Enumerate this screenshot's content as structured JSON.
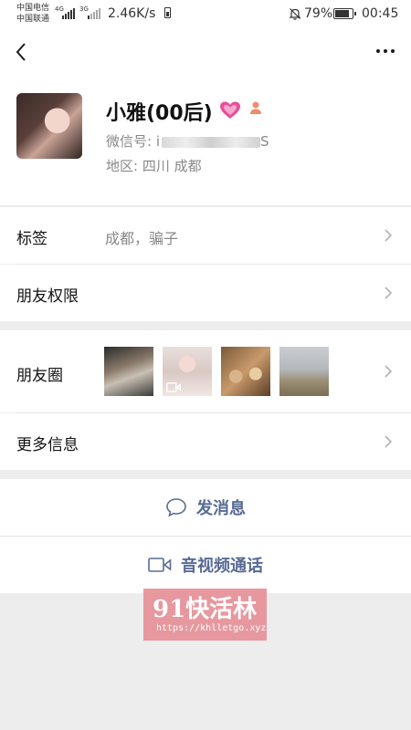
{
  "status_bar": {
    "carrier_1": "中国电信",
    "carrier_2": "中国联通",
    "network_1": "4G",
    "network_2": "3G",
    "speed": "2.46K/s",
    "battery_percent": "79%",
    "time": "00:45"
  },
  "profile": {
    "nickname": "小雅(00后)",
    "wechat_id_label": "微信号:",
    "wechat_id_value_visible": "i",
    "wechat_id_value_end": "S",
    "region_label": "地区:",
    "region_value": "四川  成都",
    "emoji": "💓"
  },
  "rows": {
    "tags_label": "标签",
    "tags_value": "成都，骗子",
    "permissions_label": "朋友权限",
    "moments_label": "朋友圈",
    "more_info_label": "更多信息"
  },
  "actions": {
    "message_label": "发消息",
    "call_label": "音视频通话"
  },
  "watermark": {
    "brand": "91快活林",
    "url": "https://khlletgo.xyz"
  },
  "colors": {
    "link_blue": "#576b95",
    "watermark_pink": "#e7949b",
    "page_bg": "#ededed"
  }
}
